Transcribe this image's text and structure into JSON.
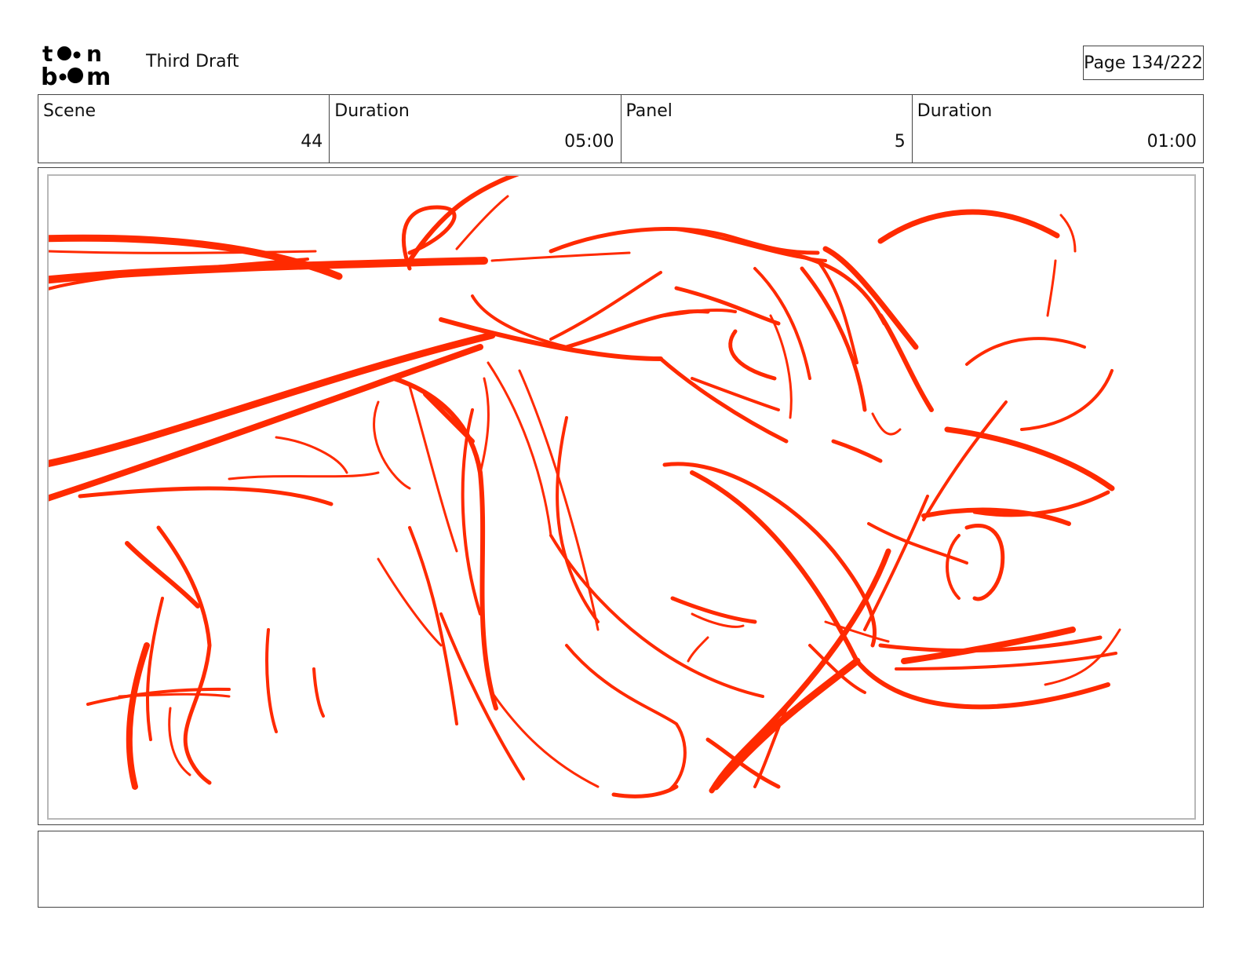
{
  "header": {
    "logo_text": [
      "to•n",
      "b••m"
    ],
    "draft_title": "Third Draft",
    "page_indicator": "Page 134/222"
  },
  "info": {
    "scene_label": "Scene",
    "scene_value": "44",
    "scene_duration_label": "Duration",
    "scene_duration_value": "05:00",
    "panel_label": "Panel",
    "panel_value": "5",
    "panel_duration_label": "Duration",
    "panel_duration_value": "01:00"
  },
  "panel": {
    "sketch_color": "#ff2a00"
  },
  "notes": {
    "text": ""
  }
}
